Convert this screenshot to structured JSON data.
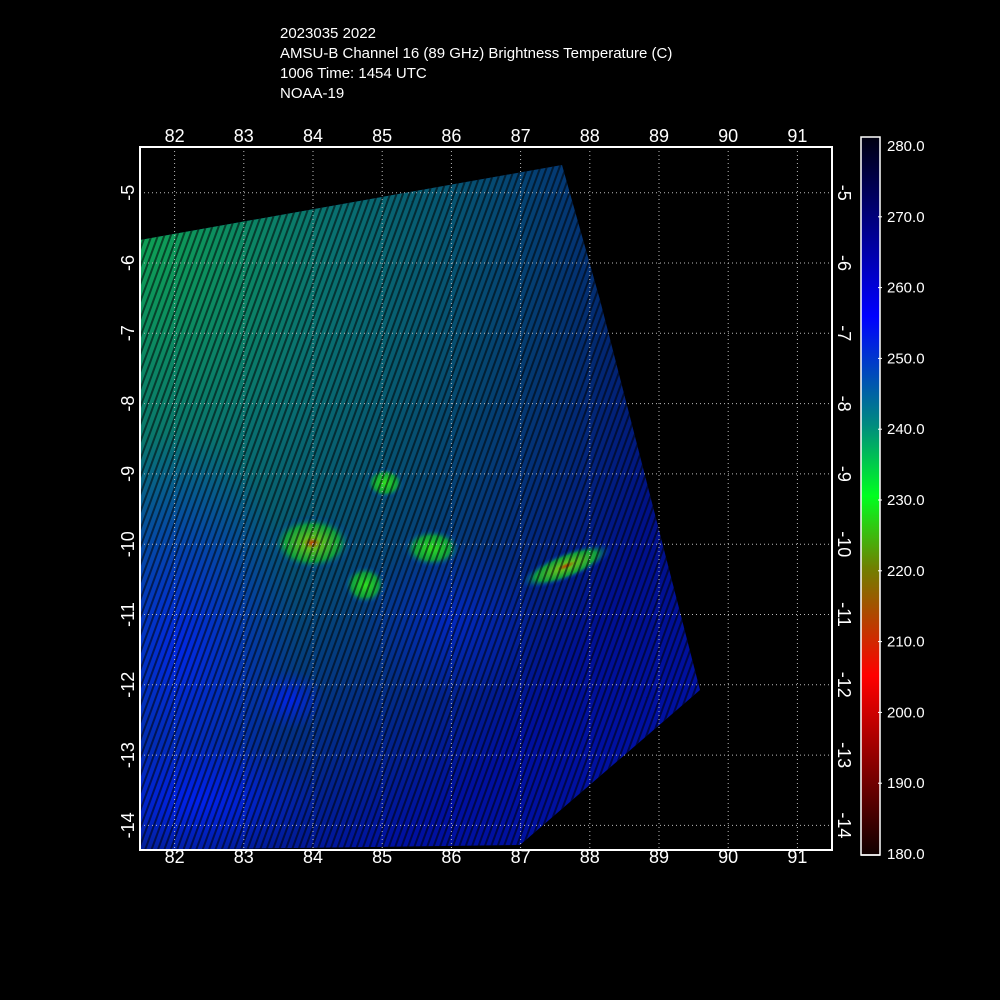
{
  "title": {
    "lines": [
      "2023035 2022",
      "AMSU-B Channel 16 (89 GHz) Brightness Temperature (C)",
      "1006 Time: 1454 UTC",
      "NOAA-19"
    ]
  },
  "chart_data": {
    "type": "heatmap",
    "title": "AMSU-B Channel 16 (89 GHz) Brightness Temperature (C)",
    "satellite": "NOAA-19",
    "xlabel": "",
    "ylabel": "",
    "x_ticks": [
      82,
      83,
      84,
      85,
      86,
      87,
      88,
      89,
      90,
      91
    ],
    "y_ticks": [
      -5,
      -6,
      -7,
      -8,
      -9,
      -10,
      -11,
      -12,
      -13,
      -14
    ],
    "xlim": [
      81.5,
      91.5
    ],
    "ylim": [
      -14.35,
      -4.35
    ],
    "grid": true,
    "colorbar": {
      "ticks": [
        "280.0",
        "270.0",
        "260.0",
        "250.0",
        "240.0",
        "230.0",
        "220.0",
        "210.0",
        "200.0",
        "190.0",
        "180.0"
      ],
      "range": [
        180,
        280
      ],
      "stops": [
        {
          "value": 280,
          "color": "#000010"
        },
        {
          "value": 270,
          "color": "#000070"
        },
        {
          "value": 255,
          "color": "#0000ff"
        },
        {
          "value": 240,
          "color": "#008a80"
        },
        {
          "value": 230,
          "color": "#00ff20"
        },
        {
          "value": 220,
          "color": "#708000"
        },
        {
          "value": 205,
          "color": "#ff0000"
        },
        {
          "value": 190,
          "color": "#700000"
        },
        {
          "value": 180,
          "color": "#100000"
        }
      ]
    },
    "features": [
      {
        "label": "cold cell",
        "lon": 84.0,
        "lat": -10.0,
        "min_temp_approx": 210
      },
      {
        "label": "cold cell",
        "lon": 85.1,
        "lat": -9.1,
        "min_temp_approx": 235
      },
      {
        "label": "cold cell",
        "lon": 84.8,
        "lat": -10.6,
        "min_temp_approx": 225
      },
      {
        "label": "cold cell",
        "lon": 85.7,
        "lat": -10.1,
        "min_temp_approx": 228
      },
      {
        "label": "cold band",
        "lon": 87.7,
        "lat": -10.3,
        "min_temp_approx": 215
      }
    ]
  }
}
